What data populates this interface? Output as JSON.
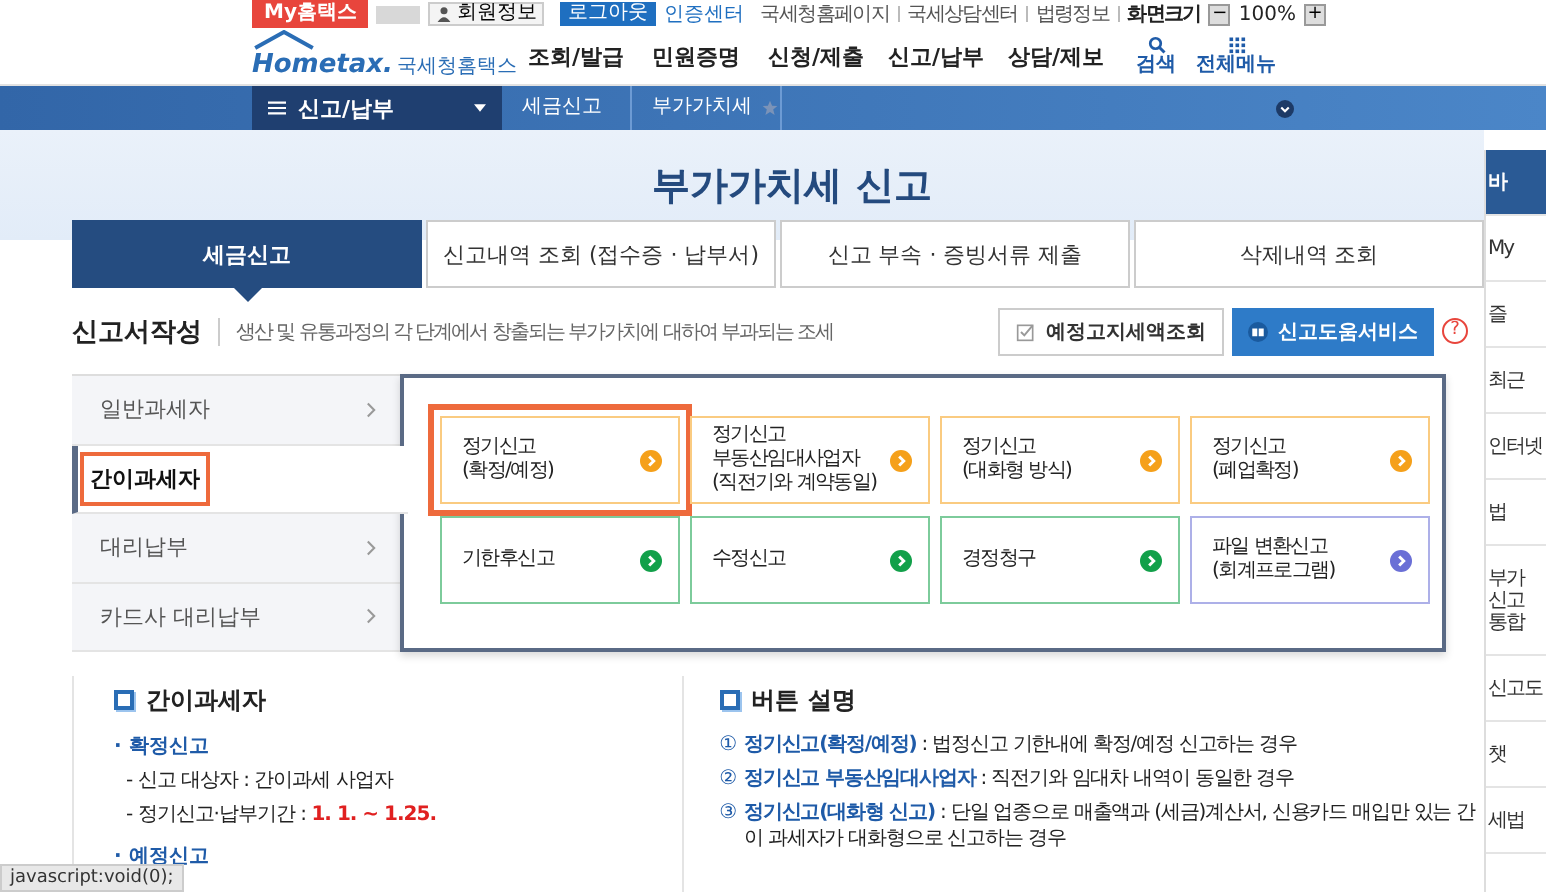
{
  "top_bar": {
    "my_hometax": "My홈택스",
    "member_info": "회원정보",
    "logout": "로그아웃",
    "cert_center": "인증센터",
    "links": [
      "국세청홈페이지",
      "국세상담센터",
      "법령정보",
      "화면크기"
    ],
    "zoom": {
      "minus": "−",
      "value": "100%",
      "plus": "+"
    }
  },
  "header": {
    "logo": "Hometax.",
    "logo_sub": "국세청홈택스",
    "menu": [
      "조회/발급",
      "민원증명",
      "신청/제출",
      "신고/납부",
      "상담/제보"
    ],
    "search": "검색",
    "all_menu": "전체메뉴"
  },
  "nav": {
    "section": "신고/납부",
    "breadcrumbs": [
      "세금신고",
      "부가가치세"
    ]
  },
  "page_title": "부가가치세 신고",
  "tabs": [
    {
      "label": "세금신고",
      "selected": true
    },
    {
      "label": "신고내역 조회 (접수증 · 납부서)",
      "selected": false
    },
    {
      "label": "신고 부속 · 증빙서류 제출",
      "selected": false
    },
    {
      "label": "삭제내역 조회",
      "selected": false
    }
  ],
  "section": {
    "title": "신고서작성",
    "description": "생산 및 유통과정의 각 단계에서 창출되는 부가가치에 대하여 부과되는 조세",
    "buttons": [
      {
        "label": "예정고지세액조회",
        "kind": "plain"
      },
      {
        "label": "신고도움서비스",
        "kind": "primary"
      }
    ],
    "help": "?"
  },
  "taxpayer_menu": [
    {
      "label": "일반과세자",
      "selected": false,
      "highlighted": false
    },
    {
      "label": "간이과세자",
      "selected": true,
      "highlighted": true
    },
    {
      "label": "대리납부",
      "selected": false,
      "highlighted": false
    },
    {
      "label": "카드사 대리납부",
      "selected": false,
      "highlighted": false
    }
  ],
  "filing_options": [
    {
      "label": "정기신고\n(확정/예정)",
      "color": "#f5a01a",
      "highlighted": true
    },
    {
      "label": "정기신고\n부동산임대사업자\n(직전기와 계약동일)",
      "color": "#f5a01a",
      "highlighted": false
    },
    {
      "label": "정기신고\n(대화형 방식)",
      "color": "#f5a01a",
      "highlighted": false
    },
    {
      "label": "정기신고\n(폐업확정)",
      "color": "#f5a01a",
      "highlighted": false
    },
    {
      "label": "기한후신고",
      "color": "#12a04a",
      "highlighted": false
    },
    {
      "label": "수정신고",
      "color": "#12a04a",
      "highlighted": false
    },
    {
      "label": "경정청구",
      "color": "#12a04a",
      "highlighted": false
    },
    {
      "label": "파일 변환신고\n(회계프로그램)",
      "color": "#6a6fd6",
      "highlighted": false
    }
  ],
  "info_left": {
    "title": "간이과세자",
    "items": [
      {
        "kind": "heading",
        "text": "· 확정신고"
      },
      {
        "kind": "detail",
        "text": "- 신고 대상자 : 간이과세 사업자"
      },
      {
        "kind": "detail",
        "text": "- 정기신고·납부기간 : ",
        "emphasis": "1. 1. ~ 1.25."
      },
      {
        "kind": "heading",
        "text": "· 예정신고"
      }
    ]
  },
  "info_right": {
    "title": "버튼 설명",
    "items": [
      {
        "num": "①",
        "term": "정기신고(확정/예정)",
        "desc": " : 법정신고 기한내에 확정/예정 신고하는 경우"
      },
      {
        "num": "②",
        "term": "정기신고 부동산임대사업자",
        "desc": " : 직전기와 임대차 내역이 동일한 경우"
      },
      {
        "num": "③",
        "term": "정기신고(대화형 신고)",
        "desc": " : 단일 업종으로 매출액과 (세금)계산서, 신용카드 매입만 있는 간이 과세자가 대화형으로 신고하는 경우"
      }
    ]
  },
  "quick_menu_title": "바",
  "quick_menu": [
    "My",
    "즐",
    "최근",
    "인터넷",
    "법",
    "부가\n신고\n통합",
    "신고도",
    "챗",
    "세법"
  ],
  "status_tooltip": "javascript:void(0);"
}
